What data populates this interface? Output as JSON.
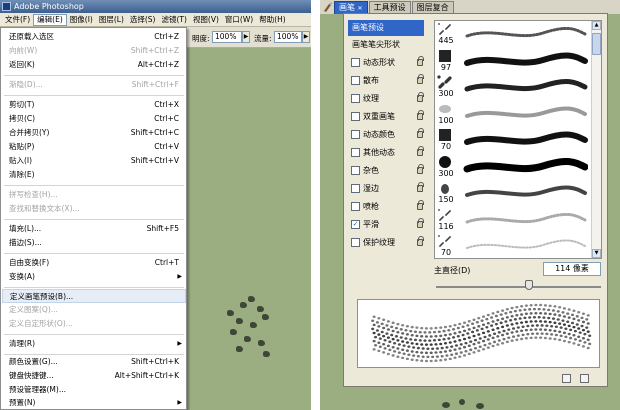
{
  "app": {
    "title": "Adobe Photoshop"
  },
  "menubar": {
    "items": [
      "文件(F)",
      "编辑(E)",
      "图像(I)",
      "图层(L)",
      "选择(S)",
      "滤镜(T)",
      "视图(V)",
      "窗口(W)",
      "帮助(H)"
    ]
  },
  "options_bar": {
    "opacity_label": "明度:",
    "opacity_value": "100%",
    "flow_label": "流量:",
    "flow_value": "100%"
  },
  "edit_menu": {
    "items": [
      {
        "label": "还原载入选区",
        "shortcut": "Ctrl+Z",
        "disabled": false
      },
      {
        "label": "向前(W)",
        "shortcut": "Shift+Ctrl+Z",
        "disabled": true
      },
      {
        "label": "返回(K)",
        "shortcut": "Alt+Ctrl+Z",
        "disabled": false
      },
      {
        "label": "渐隐(D)...",
        "shortcut": "Shift+Ctrl+F",
        "disabled": true
      },
      {
        "label": "剪切(T)",
        "shortcut": "Ctrl+X",
        "disabled": false
      },
      {
        "label": "拷贝(C)",
        "shortcut": "Ctrl+C",
        "disabled": false
      },
      {
        "label": "合并拷贝(Y)",
        "shortcut": "Shift+Ctrl+C",
        "disabled": false
      },
      {
        "label": "粘贴(P)",
        "shortcut": "Ctrl+V",
        "disabled": false
      },
      {
        "label": "贴入(I)",
        "shortcut": "Shift+Ctrl+V",
        "disabled": false
      },
      {
        "label": "清除(E)",
        "shortcut": "",
        "disabled": false
      },
      {
        "label": "拼写检查(H)...",
        "shortcut": "",
        "disabled": true
      },
      {
        "label": "查找和替换文本(X)...",
        "shortcut": "",
        "disabled": true
      },
      {
        "label": "填充(L)...",
        "shortcut": "Shift+F5",
        "disabled": false
      },
      {
        "label": "描边(S)...",
        "shortcut": "",
        "disabled": false
      },
      {
        "label": "自由变换(F)",
        "shortcut": "Ctrl+T",
        "disabled": false
      },
      {
        "label": "变换(A)",
        "shortcut": "",
        "disabled": false,
        "submenu": true
      },
      {
        "label": "定义画笔预设(B)...",
        "shortcut": "",
        "disabled": false,
        "highlighted": true
      },
      {
        "label": "定义图案(Q)...",
        "shortcut": "",
        "disabled": true
      },
      {
        "label": "定义自定形状(O)...",
        "shortcut": "",
        "disabled": true
      },
      {
        "label": "清理(R)",
        "shortcut": "",
        "disabled": false,
        "submenu": true
      },
      {
        "label": "颜色设置(G)...",
        "shortcut": "Shift+Ctrl+K",
        "disabled": false
      },
      {
        "label": "键盘快捷键...",
        "shortcut": "Alt+Shift+Ctrl+K",
        "disabled": false
      },
      {
        "label": "预设管理器(M)...",
        "shortcut": "",
        "disabled": false
      },
      {
        "label": "预置(N)",
        "shortcut": "",
        "disabled": false,
        "submenu": true
      }
    ]
  },
  "brush_palette": {
    "tabs": [
      {
        "label": "画笔",
        "active": true
      },
      {
        "label": "工具预设",
        "active": false
      },
      {
        "label": "图层复合",
        "active": false
      }
    ],
    "settings_header": "画笔预设",
    "settings_plain": "画笔笔尖形状",
    "settings": [
      {
        "label": "动态形状",
        "checked": false
      },
      {
        "label": "散布",
        "checked": false
      },
      {
        "label": "纹理",
        "checked": false
      },
      {
        "label": "双重画笔",
        "checked": false
      },
      {
        "label": "动态颜色",
        "checked": false
      },
      {
        "label": "其他动态",
        "checked": false
      },
      {
        "label": "杂色",
        "checked": false
      },
      {
        "label": "湿边",
        "checked": false
      },
      {
        "label": "喷枪",
        "checked": false
      },
      {
        "label": "平滑",
        "checked": true
      },
      {
        "label": "保护纹理",
        "checked": false
      }
    ],
    "presets": [
      "445",
      "97",
      "300",
      "100",
      "70",
      "300",
      "150",
      "116",
      "70"
    ],
    "diameter_label": "主直径(D)",
    "diameter_value": "114 像素",
    "colors": {
      "accent": "#2f66c7",
      "panel_bg": "#ece9d8",
      "canvas_bg": "#9aae82"
    }
  }
}
